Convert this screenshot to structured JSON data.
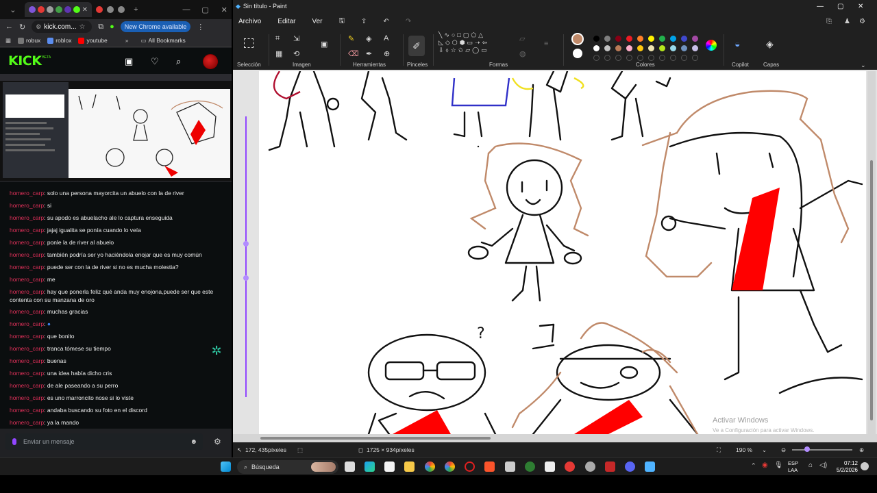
{
  "browser": {
    "address": "kick.com...",
    "update_button": "New Chrome available",
    "bookmarks": [
      {
        "label": "robux",
        "color": "#777"
      },
      {
        "label": "roblox",
        "color": "#5b8def"
      },
      {
        "label": "youtube",
        "color": "#ff0000"
      }
    ],
    "all_bookmarks": "All Bookmarks"
  },
  "kick": {
    "logo": "KICK",
    "beta": "BETA",
    "chat_placeholder": "Enviar un mensaje",
    "messages": [
      {
        "user": "homero_carp",
        "text": ": solo una persona mayorcita un abuelo con la de river"
      },
      {
        "user": "homero_carp",
        "text": ": si"
      },
      {
        "user": "homero_carp",
        "text": ": su apodo es abuelacho ale lo captura enseguida"
      },
      {
        "user": "homero_carp",
        "text": ": jajaj igualita se ponía cuando lo veía"
      },
      {
        "user": "homero_carp",
        "text": ": ponle la de river al abuelo"
      },
      {
        "user": "homero_carp",
        "text": ": también podría ser yo haciéndola enojar que es muy común"
      },
      {
        "user": "homero_carp",
        "text": ": puede ser con la de river si no es mucha molestia?"
      },
      {
        "user": "homero_carp",
        "text": ": me"
      },
      {
        "user": "homero_carp",
        "text": ": hay que ponerla feliz qué anda muy enojona,puede ser que este contenta con su manzana de oro"
      },
      {
        "user": "homero_carp",
        "text": ": muchas gracias"
      },
      {
        "user": "homero_carp",
        "text": ":"
      },
      {
        "user": "homero_carp",
        "text": ": que bonito"
      },
      {
        "user": "homero_carp",
        "text": ": tranca tómese su tiempo"
      },
      {
        "user": "homero_carp",
        "text": ": buenas"
      },
      {
        "user": "homero_carp",
        "text": ": una idea había dicho cris"
      },
      {
        "user": "homero_carp",
        "text": ": de ale paseando a su perro"
      },
      {
        "user": "homero_carp",
        "text": ": es uno marroncito nose si lo viste"
      },
      {
        "user": "homero_carp",
        "text": ": andaba buscando su foto en el discord"
      },
      {
        "user": "homero_carp",
        "text": ": ya la mando"
      }
    ]
  },
  "paint": {
    "title": "Sin título - Paint",
    "menu": [
      "Archivo",
      "Editar",
      "Ver"
    ],
    "groups": [
      "Selección",
      "Imagen",
      "Herramientas",
      "Pinceles",
      "Formas",
      "Colores",
      "Copilot",
      "Capas"
    ],
    "status": {
      "cursor": "172, 435píxeles",
      "size": "1725 × 934píxeles",
      "zoom": "190 %"
    },
    "watermark_title": "Activar Windows",
    "watermark_sub": "Ve a Configuración para activar Windows."
  },
  "taskbar": {
    "search": "Búsqueda",
    "lang_top": "ESP",
    "lang_bottom": "LAA",
    "time": "07:12",
    "date": "5/2/2026"
  },
  "colors": {
    "kick_green": "#53fc18",
    "chat_user": "#e0305a",
    "river_red": "#ff0000",
    "hair_brown": "#c08a6a"
  }
}
